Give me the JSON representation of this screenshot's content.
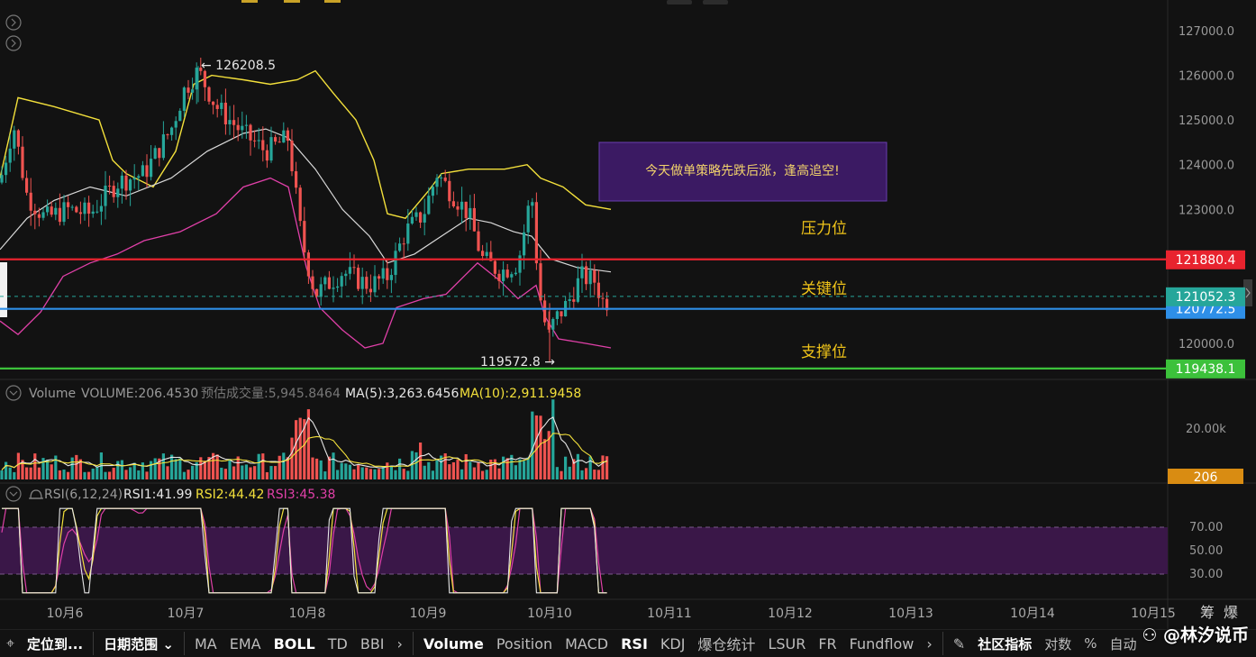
{
  "price_axis": {
    "ticks": [
      "127000.0",
      "126000.0",
      "125000.0",
      "124000.0",
      "123000.0",
      "120000.0"
    ],
    "tick_values": [
      127000,
      126000,
      125000,
      124000,
      123000,
      120000
    ],
    "ymin": 118900,
    "ymax": 127700
  },
  "levels": [
    {
      "name": "resistance",
      "value": 121880.4,
      "label": "121880.4",
      "color": "#e8232e",
      "zone_label": "压力位"
    },
    {
      "name": "key",
      "value": 120772.5,
      "label": "120772.5",
      "color": "#2e8fe8",
      "zone_label": "关键位"
    },
    {
      "name": "support",
      "value": 119438.1,
      "label": "119438.1",
      "color": "#3cc13b",
      "zone_label": "支撑位"
    }
  ],
  "current_price": {
    "value": 121052.3,
    "label": "121052.3",
    "color": "#26a69a"
  },
  "annotations": {
    "high": "← 126208.5",
    "high_value": 126208.5,
    "low": "119572.8 →",
    "low_value": 119572.8,
    "strategy": "今天做单策略先跌后涨，逢高追空!"
  },
  "volume_legend": {
    "title": "Volume",
    "volume": "VOLUME:206.4530",
    "estimate": "预估成交量:5,945.8464",
    "ma5": "MA(5):3,263.6456",
    "ma10": "MA(10):2,911.9458"
  },
  "volume_axis": {
    "tick": "20.00k",
    "current": "206"
  },
  "rsi_legend": {
    "title": "RSI(6,12,24)",
    "rsi1": "RSI1:41.99",
    "rsi2": "RSI2:44.42",
    "rsi3": "RSI3:45.38"
  },
  "rsi_axis": {
    "ticks": [
      "70.00",
      "50.00",
      "30.00"
    ]
  },
  "dates": [
    "10月6",
    "10月7",
    "10月8",
    "10月9",
    "10月10",
    "10月11",
    "10月12",
    "10月13",
    "10月14",
    "10月15"
  ],
  "corner": [
    "筹",
    "爆"
  ],
  "toolbar": {
    "locate": "定位到...",
    "date_range": "日期范围",
    "indicators_main": [
      "MA",
      "EMA",
      "BOLL",
      "TD",
      "BBI"
    ],
    "indicators_sub": [
      "Volume",
      "Position",
      "MACD",
      "RSI",
      "KDJ",
      "爆仓统计",
      "LSUR",
      "FR",
      "Fundflow"
    ],
    "community": "社区指标",
    "compare": "对数",
    "percent": "%",
    "auto": "自动"
  },
  "brand": "@林汐说币",
  "colors": {
    "up": "#26a69a",
    "down": "#ef5350",
    "boll_up": "#f3e03b",
    "boll_mid": "#d9d9d9",
    "boll_low": "#e040a8",
    "rsi_zone": "#3a1748"
  }
}
